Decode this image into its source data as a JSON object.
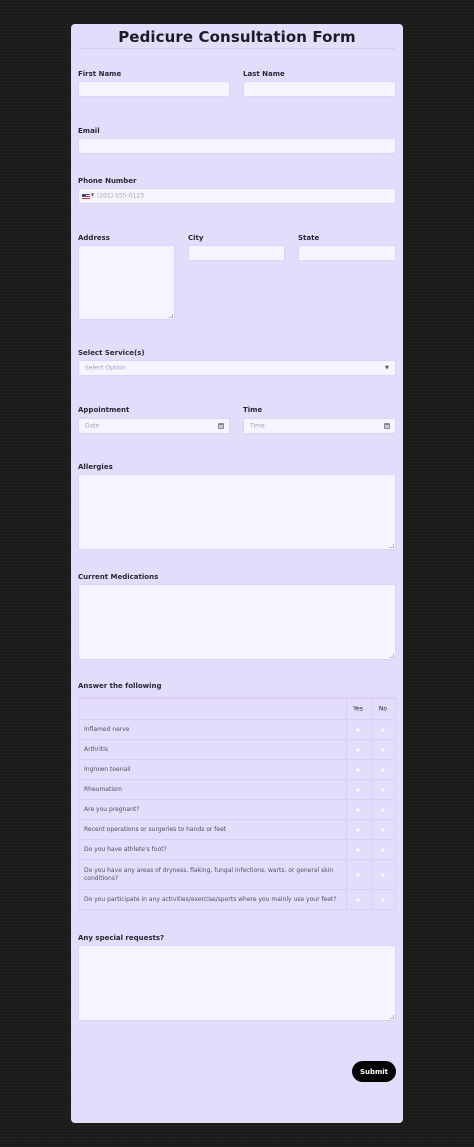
{
  "form": {
    "title": "Pedicure Consultation Form",
    "labels": {
      "first_name": "First Name",
      "last_name": "Last Name",
      "email": "Email",
      "phone": "Phone Number",
      "address": "Address",
      "city": "City",
      "state": "State",
      "services": "Select Service(s)",
      "appointment": "Appointment",
      "time": "Time",
      "allergies": "Allergies",
      "medications": "Current Medications",
      "matrix": "Answer the following",
      "special_requests": "Any special requests?"
    },
    "placeholders": {
      "phone": "(201) 555-0123",
      "services": "Select Option",
      "date": "Date",
      "time": "Time"
    },
    "matrix": {
      "columns": [
        "Yes",
        "No"
      ],
      "questions": [
        "Inflamed nerve",
        "Arthritis",
        "Ingrown toenail",
        "Rheumatism",
        "Are you pregnant?",
        "Recent operations or surgeries to hands or feet",
        "Do you have athlete's foot?",
        "Do you have any areas of dryness, flaking, fungal infections, warts, or general skin conditions?",
        "Do you participate in any activities/exercise/sports where you mainly use your feet?"
      ]
    },
    "submit_label": "Submit",
    "icons": {
      "phone_country": "us-flag-icon",
      "services": "chevron-down-icon",
      "date": "calendar-icon",
      "time": "calendar-icon"
    },
    "colors": {
      "page_background": "#1c1a19",
      "form_background": "#e4dcfb",
      "input_background": "#f7f4ff",
      "submit_background": "#050505"
    }
  }
}
